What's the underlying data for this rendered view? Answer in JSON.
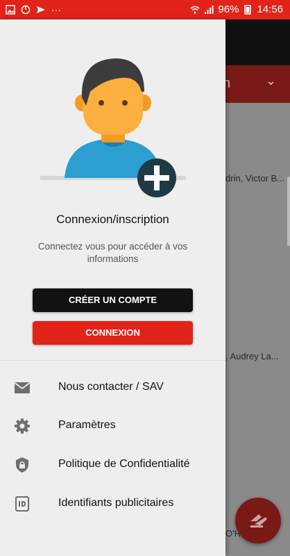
{
  "status_bar": {
    "dots": "···",
    "battery": "96%",
    "time": "14:56"
  },
  "background": {
    "tab_text": "n",
    "row1_text": "drin, Victor B...",
    "row2_text": ", Audrey La...",
    "row3_text": "O'Ha..."
  },
  "drawer": {
    "title": "Connexion/inscription",
    "subtitle": "Connectez vous pour accéder à vos informations",
    "create_account_label": "CRÉER UN COMPTE",
    "login_label": "CONNEXION",
    "menu": [
      {
        "label": "Nous contacter / SAV",
        "icon": "mail-icon"
      },
      {
        "label": "Paramètres",
        "icon": "gear-icon"
      },
      {
        "label": "Politique de Confidentialité",
        "icon": "shield-lock-icon"
      },
      {
        "label": "Identifiants publicitaires",
        "icon": "id-card-icon"
      }
    ]
  },
  "colors": {
    "accent_red": "#e2231a",
    "dark_button": "#121212",
    "drawer_bg": "#eeeeee",
    "avatar_shirt": "#2a9fd0",
    "avatar_skin": "#fbb040",
    "plus_badge": "#1f3a44"
  }
}
